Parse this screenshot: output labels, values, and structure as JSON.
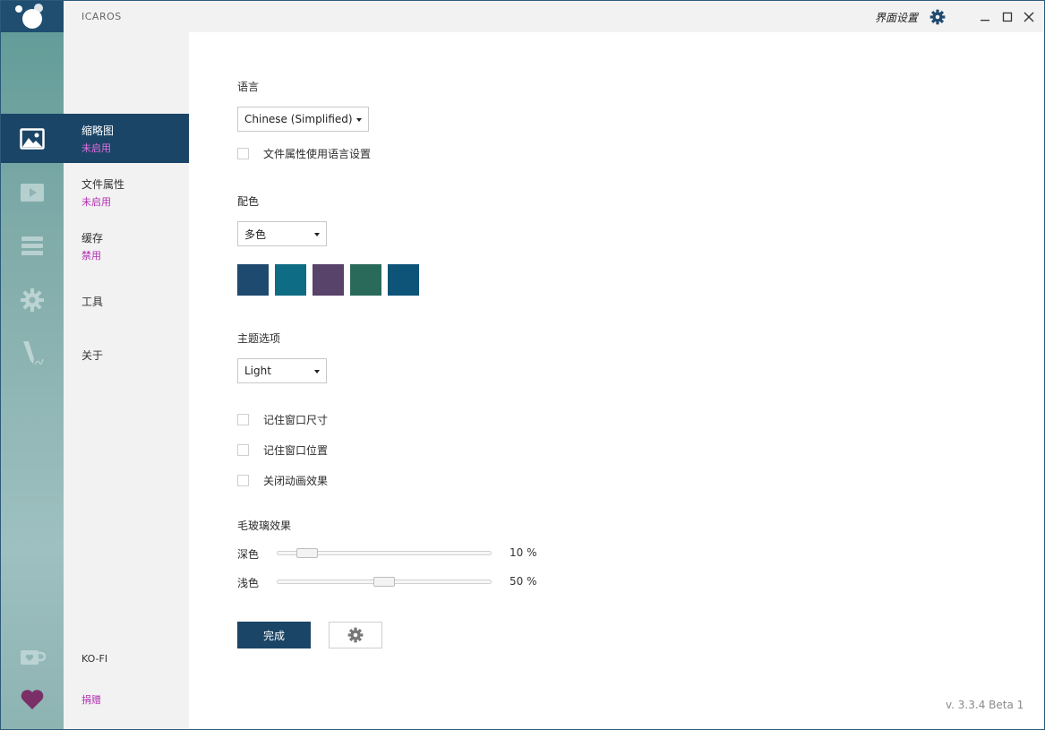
{
  "app": {
    "name": "ICAROS"
  },
  "titlebar": {
    "ui_settings_label": "界面设置",
    "gear_icon": "gear-icon",
    "minimize_icon": "minimize-icon",
    "maximize_icon": "maximize-icon",
    "close_icon": "close-icon"
  },
  "rail": {
    "items": [
      {
        "icon": "image-icon"
      },
      {
        "icon": "play-icon"
      },
      {
        "icon": "stack-icon"
      },
      {
        "icon": "gear-tool-icon"
      },
      {
        "icon": "pen-icon"
      },
      {
        "icon": "coffee-cup-icon"
      },
      {
        "icon": "heart-icon"
      }
    ]
  },
  "nav": {
    "items": [
      {
        "title": "缩略图",
        "status": "未启用"
      },
      {
        "title": "文件属性",
        "status": "未启用"
      },
      {
        "title": "缓存",
        "status": "禁用"
      },
      {
        "title": "工具"
      },
      {
        "title": "关于"
      }
    ],
    "kofi": "KO-FI",
    "donate": "捐赠"
  },
  "settings": {
    "language": {
      "label": "语言",
      "selected": "Chinese (Simplified)",
      "checkbox_label": "文件属性使用语言设置"
    },
    "color": {
      "label": "配色",
      "selected": "多色",
      "swatches": [
        "#1f4a6f",
        "#0e6c84",
        "#58436b",
        "#2a6a5b",
        "#0d5478"
      ]
    },
    "theme": {
      "label": "主题选项",
      "selected": "Light"
    },
    "options": [
      {
        "label": "记住窗口尺寸",
        "checked": false
      },
      {
        "label": "记住窗口位置",
        "checked": false
      },
      {
        "label": "关闭动画效果",
        "checked": false
      }
    ],
    "frosted": {
      "label": "毛玻璃效果",
      "dark": {
        "label": "深色",
        "value_text": "10 %",
        "value": 0.1
      },
      "light": {
        "label": "浅色",
        "value_text": "50 %",
        "value": 0.5
      }
    },
    "done_label": "完成"
  },
  "version": "v. 3.3.4 Beta 1"
}
